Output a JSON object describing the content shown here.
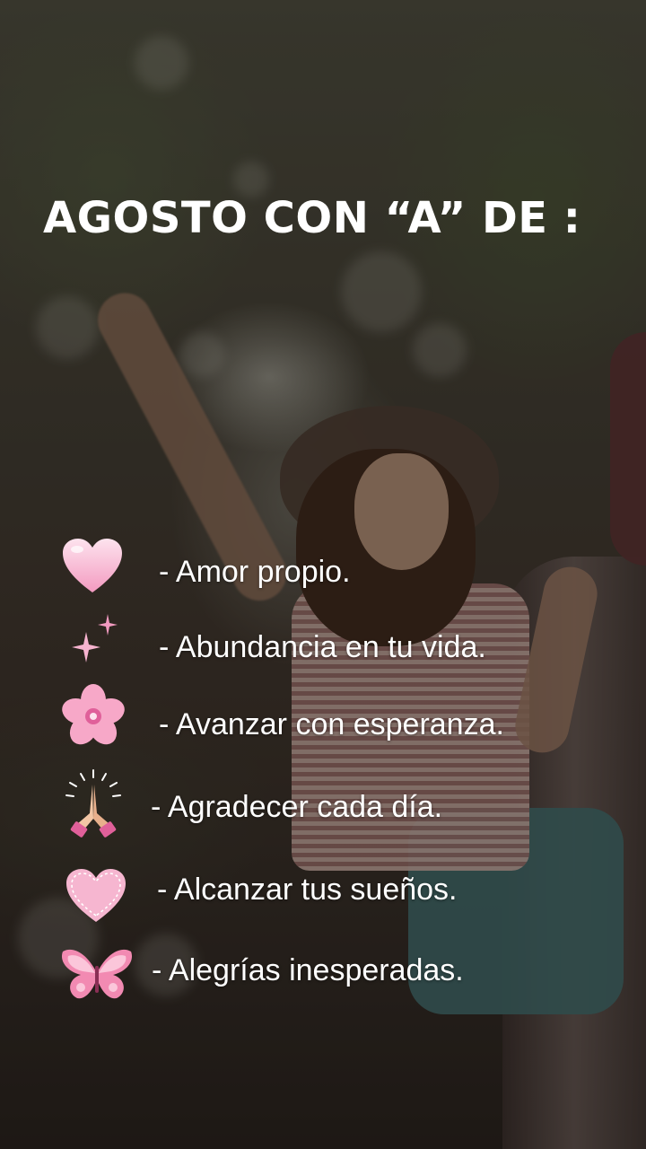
{
  "title": "AGOSTO CON “A” DE :",
  "items": [
    {
      "icon": "pink-heart-icon",
      "text": "- Amor propio."
    },
    {
      "icon": "sparkles-icon",
      "text": "- Abundancia en tu vida."
    },
    {
      "icon": "pink-flower-icon",
      "text": "- Avanzar con esperanza."
    },
    {
      "icon": "praying-hands-icon",
      "text": "- Agradecer cada día."
    },
    {
      "icon": "stitched-heart-icon",
      "text": "- Alcanzar tus sueños."
    },
    {
      "icon": "pink-butterfly-icon",
      "text": "- Alegrías inesperadas."
    }
  ],
  "colors": {
    "text": "#ffffff",
    "accent_pink": "#f7a8c8",
    "deep_pink": "#e0609a"
  }
}
